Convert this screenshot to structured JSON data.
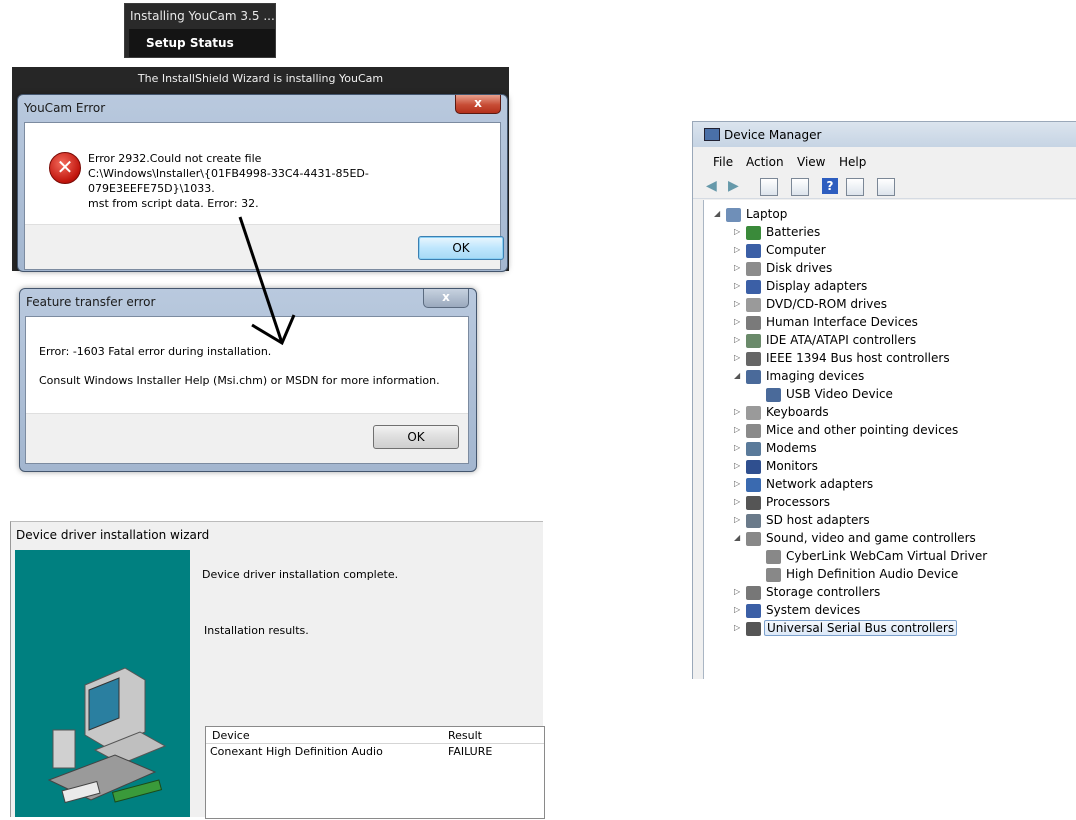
{
  "setup_status": {
    "title": "Installing YouCam 3.5 ...",
    "bar_label": "Setup Status"
  },
  "installshield": {
    "caption": "The InstallShield Wizard is installing YouCam"
  },
  "youcam_error": {
    "title": "YouCam Error",
    "close": "x",
    "message_lines": [
      "Error 2932.Could not create file",
      "C:\\Windows\\Installer\\{01FB4998-33C4-4431-85ED-079E3EEFE75D}\\1033.",
      "mst from script data. Error: 32."
    ],
    "ok_label": "OK"
  },
  "feature_transfer": {
    "title": "Feature transfer error",
    "close": "x",
    "line1": "Error: -1603  Fatal error during installation.",
    "line2": "Consult Windows Installer Help (Msi.chm) or MSDN for more information.",
    "ok_label": "OK"
  },
  "device_manager": {
    "title": "Device Manager",
    "menu": [
      "File",
      "Action",
      "View",
      "Help"
    ],
    "tree": {
      "root": "Laptop",
      "nodes": [
        {
          "label": "Batteries",
          "expanded": false,
          "color": "#3a8a3a"
        },
        {
          "label": "Computer",
          "expanded": false,
          "color": "#3b5fa6"
        },
        {
          "label": "Disk drives",
          "expanded": false,
          "color": "#8c8c8c"
        },
        {
          "label": "Display adapters",
          "expanded": false,
          "color": "#3b5fa6"
        },
        {
          "label": "DVD/CD-ROM drives",
          "expanded": false,
          "color": "#9a9a9a"
        },
        {
          "label": "Human Interface Devices",
          "expanded": false,
          "color": "#7a7a7a"
        },
        {
          "label": "IDE ATA/ATAPI controllers",
          "expanded": false,
          "color": "#6a8a6a"
        },
        {
          "label": "IEEE 1394 Bus host controllers",
          "expanded": false,
          "color": "#666666"
        },
        {
          "label": "Imaging devices",
          "expanded": true,
          "color": "#4a6a9a",
          "children": [
            "USB Video Device"
          ]
        },
        {
          "label": "Keyboards",
          "expanded": false,
          "color": "#9a9a9a"
        },
        {
          "label": "Mice and other pointing devices",
          "expanded": false,
          "color": "#8a8a8a"
        },
        {
          "label": "Modems",
          "expanded": false,
          "color": "#5a7a9a"
        },
        {
          "label": "Monitors",
          "expanded": false,
          "color": "#2f4f8f"
        },
        {
          "label": "Network adapters",
          "expanded": false,
          "color": "#3a6ab0"
        },
        {
          "label": "Processors",
          "expanded": false,
          "color": "#555555"
        },
        {
          "label": "SD host adapters",
          "expanded": false,
          "color": "#6a7a8a"
        },
        {
          "label": "Sound, video and game controllers",
          "expanded": true,
          "color": "#888888",
          "children": [
            "CyberLink WebCam Virtual Driver",
            "High Definition Audio Device"
          ]
        },
        {
          "label": "Storage controllers",
          "expanded": false,
          "color": "#777777"
        },
        {
          "label": "System devices",
          "expanded": false,
          "color": "#3b5fa6"
        },
        {
          "label": "Universal Serial Bus controllers",
          "expanded": false,
          "color": "#555555",
          "selected": true
        }
      ]
    }
  },
  "driver_wizard": {
    "title": "Device driver installation wizard",
    "status": "Device driver installation complete.",
    "results_label": "Installation results.",
    "columns": [
      "Device",
      "Result"
    ],
    "rows": [
      {
        "device": "Conexant High Definition Audio",
        "result": "FAILURE"
      }
    ]
  }
}
